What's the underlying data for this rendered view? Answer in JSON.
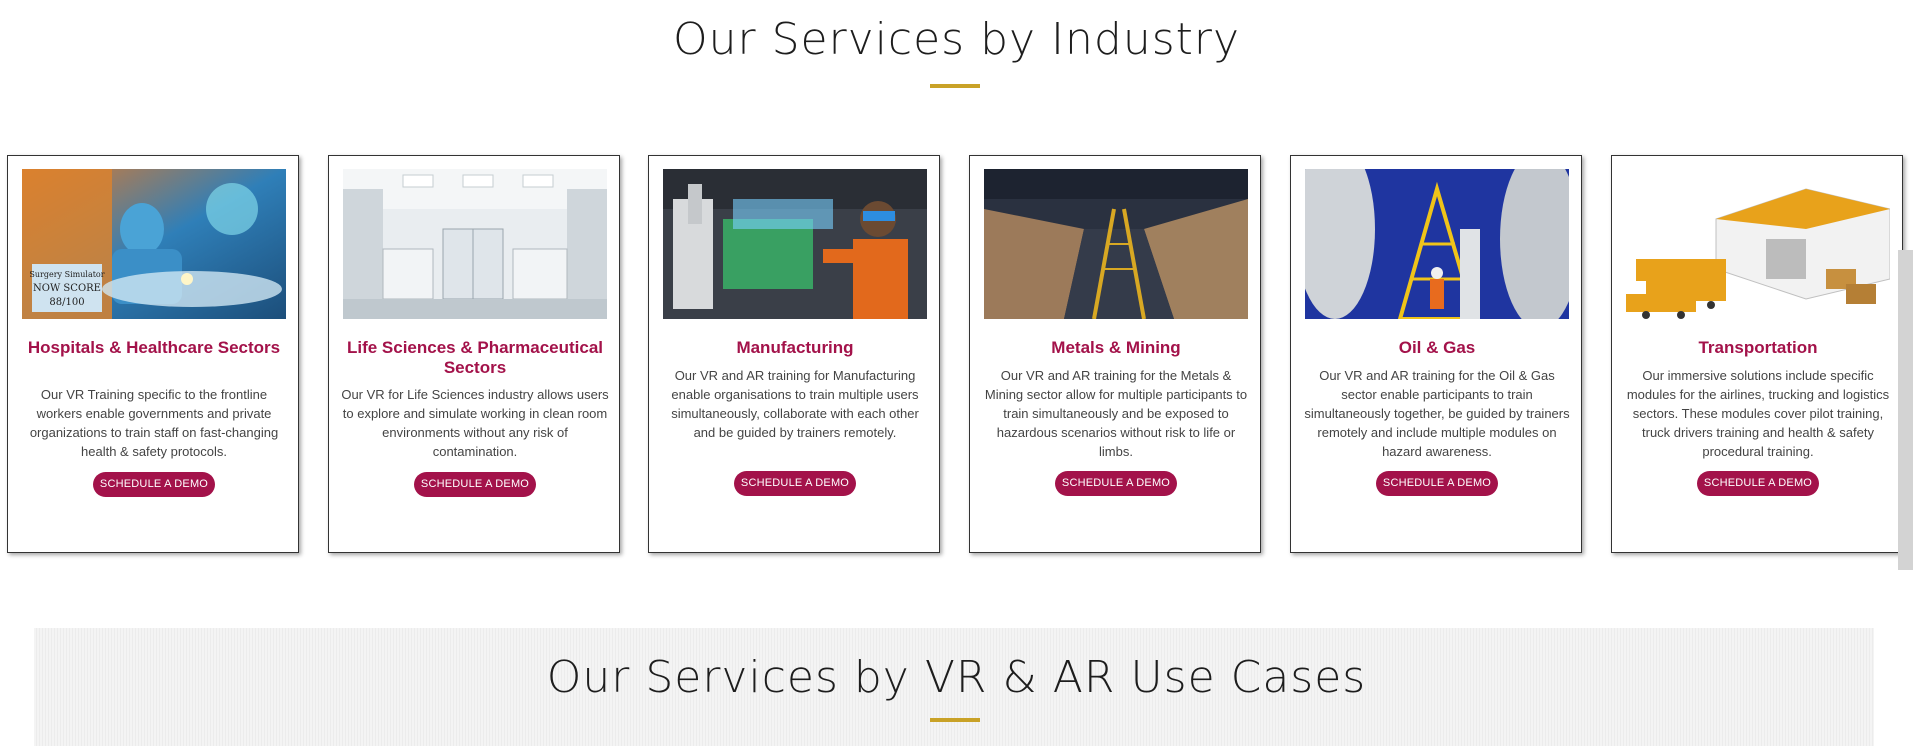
{
  "industry_section": {
    "title": "Our Services by Industry"
  },
  "cards": [
    {
      "title": "Hospitals & Healthcare Sectors",
      "description": "Our VR Training specific to the frontline workers enable governments and private organizations to train staff on fast-changing health & safety protocols.",
      "button_label": "SCHEDULE A DEMO",
      "image_text_1": "Surgery Simulator",
      "image_text_2": "NOW SCORE",
      "image_text_3": "88/100"
    },
    {
      "title": "Life Sciences & Pharmaceutical Sectors",
      "description": "Our VR for Life Sciences industry allows users to explore and simulate working in clean room environments without any risk of contamination.",
      "button_label": "SCHEDULE A DEMO"
    },
    {
      "title": "Manufacturing",
      "description": "Our VR and AR training for Manufacturing enable organisations to train multiple users simultaneously, collaborate with each other and be guided by trainers remotely.",
      "button_label": "SCHEDULE A DEMO"
    },
    {
      "title": "Metals & Mining",
      "description": "Our VR and AR training for the Metals & Mining sector allow for multiple participants to train simultaneously and be exposed to hazardous scenarios without risk to life or limbs.",
      "button_label": "SCHEDULE A DEMO"
    },
    {
      "title": "Oil & Gas",
      "description": "Our VR and AR training for the Oil & Gas sector enable participants to train simultaneously together, be guided by trainers remotely and include multiple modules on hazard awareness.",
      "button_label": "SCHEDULE A DEMO"
    },
    {
      "title": "Transportation",
      "description": "Our immersive solutions include specific modules for the airlines, trucking and logistics sectors. These modules cover pilot training, truck drivers training and health & safety procedural training.",
      "button_label": "SCHEDULE A DEMO"
    }
  ],
  "use_case_section": {
    "title": "Our Services by VR & AR Use Cases"
  },
  "colors": {
    "accent": "#a3124a",
    "underline": "#c9a227"
  }
}
